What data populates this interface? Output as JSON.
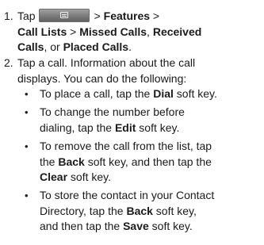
{
  "step1": {
    "number": "1.",
    "tap": "Tap",
    "menu_icon": "menu-softkey-icon",
    "sep1": "> ",
    "features": "Features",
    "sep2": " >",
    "call_lists": "Call Lists",
    "sep3": " > ",
    "missed": "Missed Calls",
    "comma1": ", ",
    "received_a": "Received",
    "received_b": "Calls",
    "or": ", or ",
    "placed": "Placed Calls",
    "period": "."
  },
  "step2": {
    "number": "2.",
    "line1": "Tap a call. Information about the call",
    "line2": "displays. You can do the following:",
    "bullets": [
      {
        "pre": "To place a call, tap the ",
        "key": "Dial",
        "post": " soft key."
      },
      {
        "line1": "To change the number before",
        "pre": "dialing, tap the ",
        "key": "Edit",
        "post": " soft key."
      },
      {
        "line1": "To remove the call from the list, tap",
        "pre": "the ",
        "key1": "Back",
        "mid": " soft key, and then tap the",
        "key2": "Clear",
        "post": " soft key."
      },
      {
        "line1": "To store the contact in your Contact",
        "pre": "Directory, tap the ",
        "key1": "Back",
        "mid": " soft key,",
        "pre2": "and then tap the ",
        "key2": "Save",
        "post": " soft key."
      }
    ],
    "bullet_glyph": "•"
  }
}
